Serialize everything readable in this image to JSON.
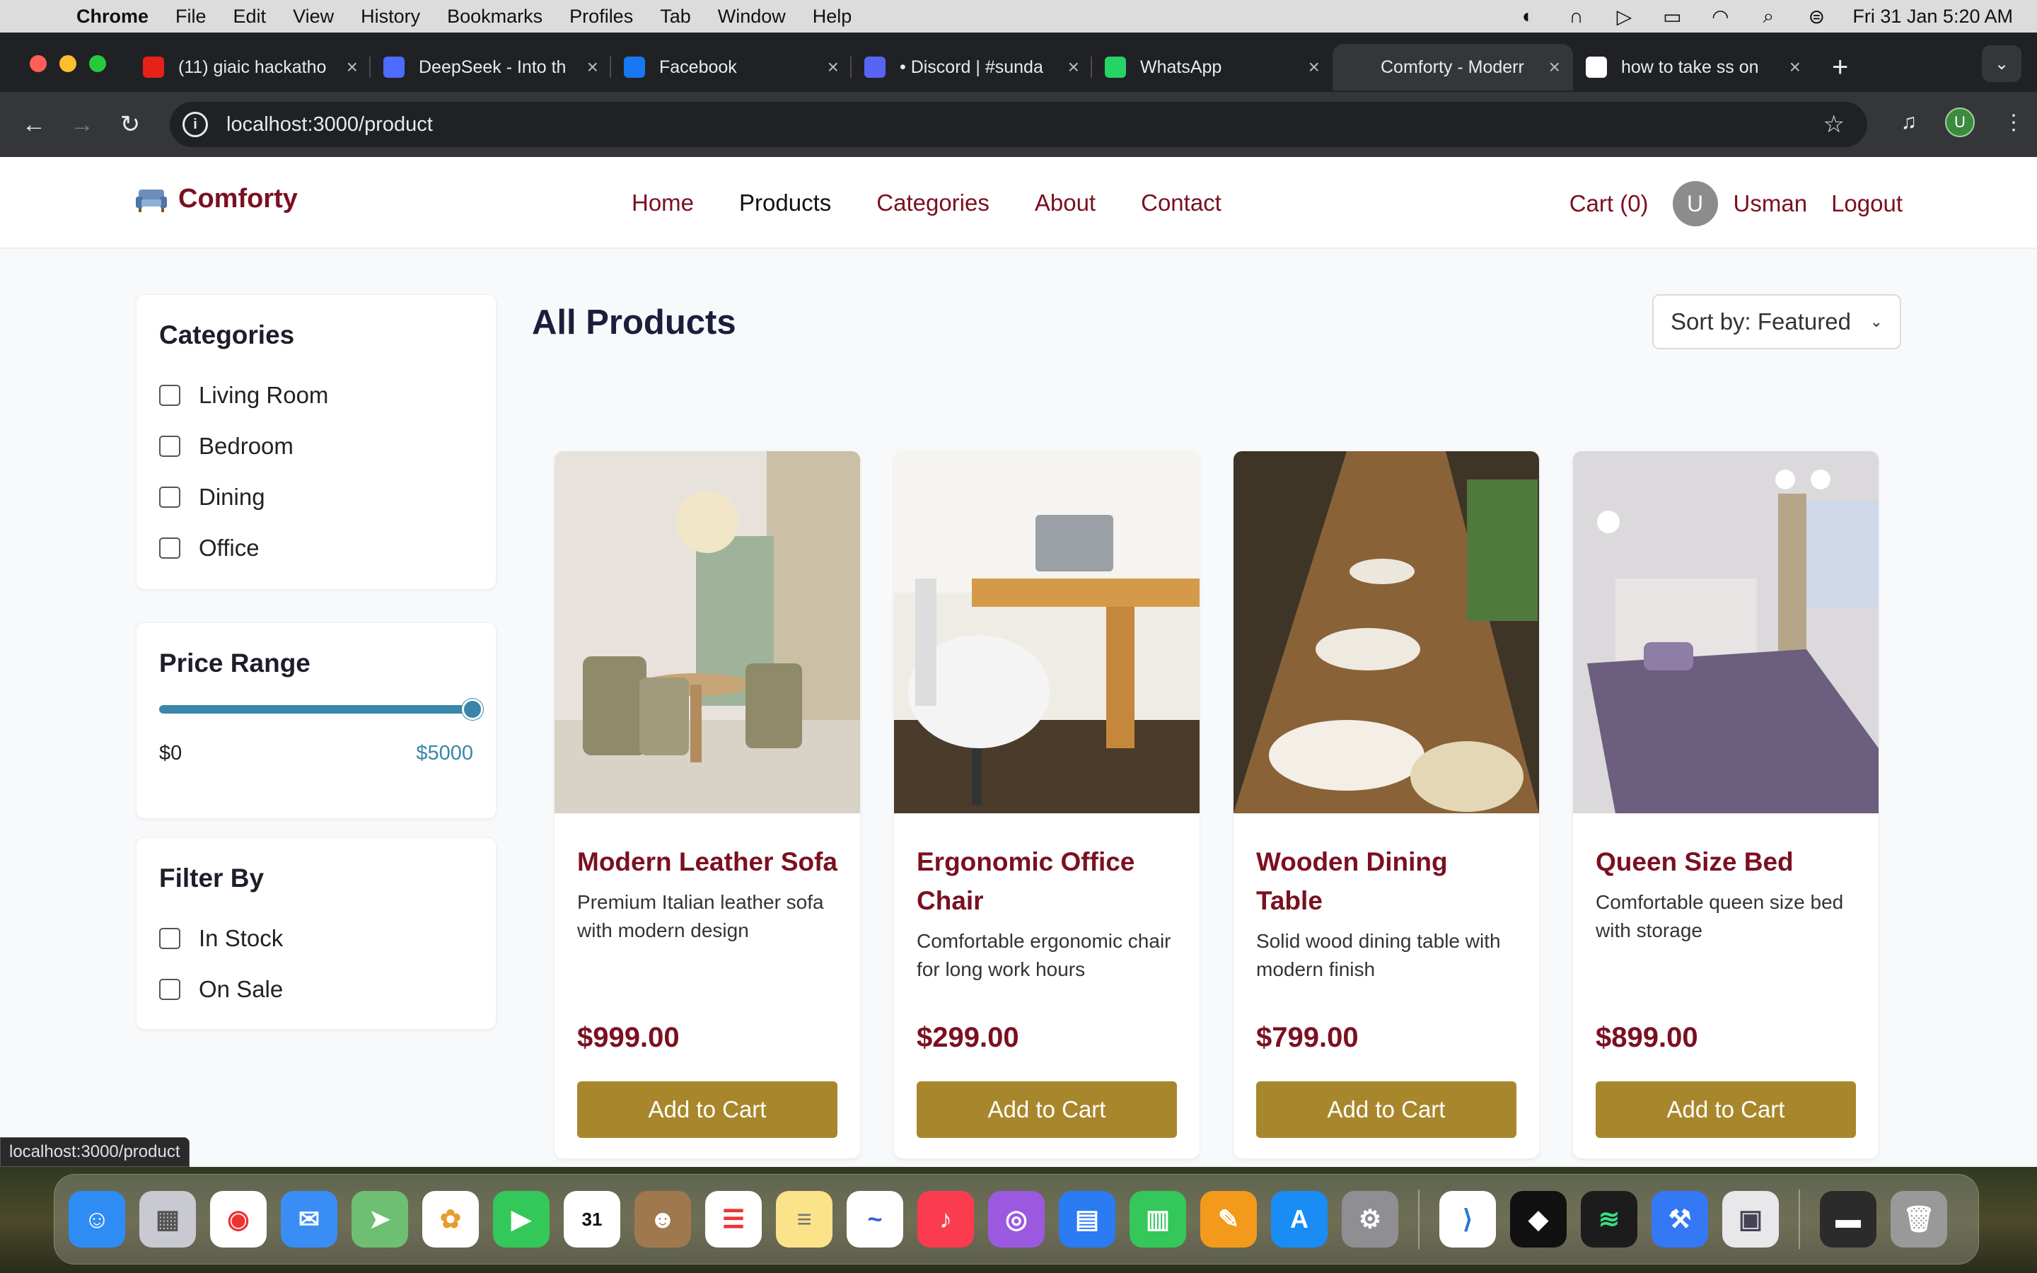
{
  "menubar": {
    "app": "Chrome",
    "items": [
      "File",
      "Edit",
      "View",
      "History",
      "Bookmarks",
      "Profiles",
      "Tab",
      "Window",
      "Help"
    ],
    "clock": "Fri 31 Jan  5:20 AM"
  },
  "tabs": [
    {
      "title": "(11) giaic hackatho",
      "icon": "youtube-icon",
      "color": "#e62117"
    },
    {
      "title": "DeepSeek - Into th",
      "icon": "deepseek-icon",
      "color": "#4d6bfe"
    },
    {
      "title": "Facebook",
      "icon": "facebook-icon",
      "color": "#1877f2"
    },
    {
      "title": "• Discord | #sunda",
      "icon": "discord-icon",
      "color": "#5865f2"
    },
    {
      "title": "WhatsApp",
      "icon": "whatsapp-icon",
      "color": "#25d366"
    },
    {
      "title": "Comforty - Moderr",
      "icon": "page-icon",
      "color": "#35363a"
    },
    {
      "title": "how to take ss on",
      "icon": "google-icon",
      "color": "#ffffff"
    }
  ],
  "address": {
    "url": "localhost:3000/product"
  },
  "site": {
    "brand": "Comforty",
    "nav": [
      "Home",
      "Products",
      "Categories",
      "About",
      "Contact"
    ],
    "cart": "Cart (0)",
    "user_initial": "U",
    "user_name": "Usman",
    "logout": "Logout"
  },
  "filters": {
    "categories_title": "Categories",
    "categories": [
      "Living Room",
      "Bedroom",
      "Dining",
      "Office"
    ],
    "price_title": "Price Range",
    "price_min": "$0",
    "price_max": "$5000",
    "price_slider_fraction": 1.0,
    "filter_title": "Filter By",
    "filter_options": [
      "In Stock",
      "On Sale"
    ]
  },
  "main": {
    "title": "All Products",
    "sort": "Sort by: Featured"
  },
  "products": [
    {
      "name": "Modern Leather Sofa",
      "desc": "Premium Italian leather sofa with modern design",
      "price": "$999.00",
      "button": "Add to Cart"
    },
    {
      "name": "Ergonomic Office Chair",
      "desc": "Comfortable ergonomic chair for long work hours",
      "price": "$299.00",
      "button": "Add to Cart"
    },
    {
      "name": "Wooden Dining Table",
      "desc": "Solid wood dining table with modern finish",
      "price": "$799.00",
      "button": "Add to Cart"
    },
    {
      "name": "Queen Size Bed",
      "desc": "Comfortable queen size bed with storage",
      "price": "$899.00",
      "button": "Add to Cart"
    }
  ],
  "status_url": "localhost:3000/product",
  "colors": {
    "brand": "#7a1020",
    "accent": "#a8872c",
    "slider": "#3a86a8"
  }
}
